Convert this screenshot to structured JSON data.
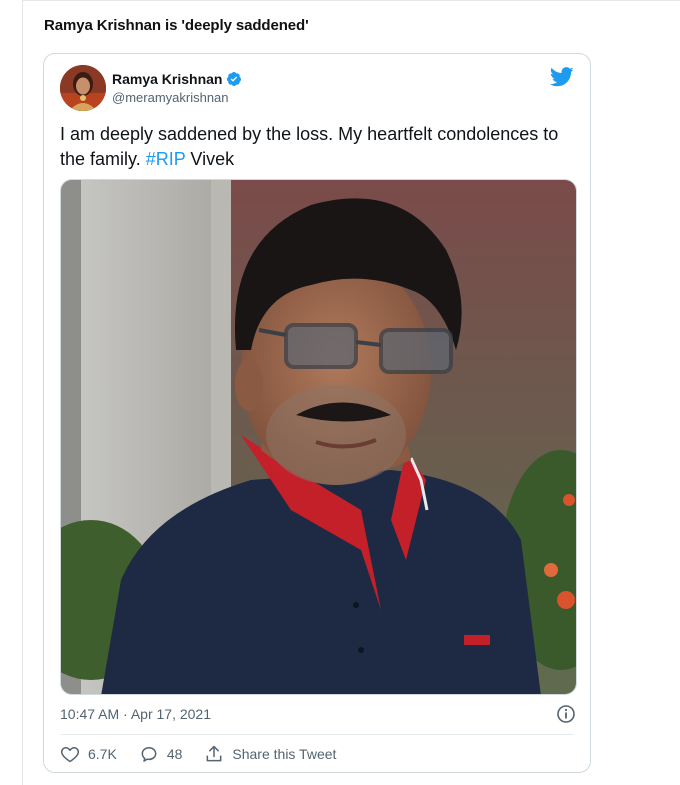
{
  "article": {
    "headline": "Ramya Krishnan is 'deeply saddened'"
  },
  "tweet": {
    "display_name": "Ramya Krishnan",
    "handle": "@meramyakrishnan",
    "verified_icon": "verified-badge-icon",
    "text_before": "I am deeply saddened by the loss. My heartfelt condolences to the family. ",
    "hashtag": "#RIP",
    "text_after": " Vivek",
    "timestamp": "10:47 AM · Apr 17, 2021",
    "likes": "6.7K",
    "replies": "48",
    "share_label": "Share this Tweet"
  },
  "colors": {
    "brand": "#1d9bf0",
    "text": "#0f1419",
    "muted": "#536471",
    "border": "#cfd9de"
  },
  "icons": [
    "twitter-bird-icon",
    "verified-badge-icon",
    "info-icon",
    "heart-icon",
    "reply-icon",
    "share-icon"
  ]
}
